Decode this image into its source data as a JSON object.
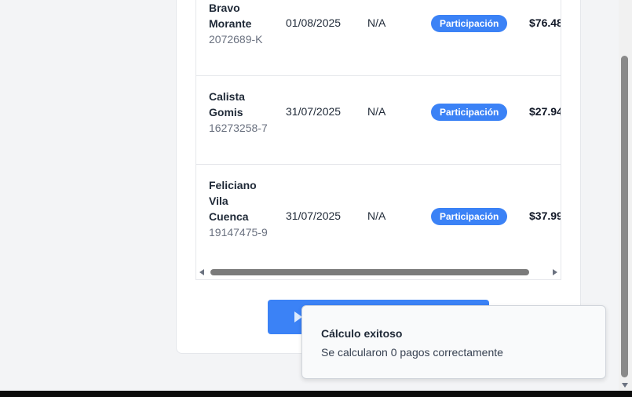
{
  "table": {
    "rows": [
      {
        "name": "Bravo Morante",
        "rut": "2072689-K",
        "date": "01/08/2025",
        "na": "N/A",
        "badge": "Participación",
        "amount": "$76.48"
      },
      {
        "name": "Calista Gomis",
        "rut": "16273258-7",
        "date": "31/07/2025",
        "na": "N/A",
        "badge": "Participación",
        "amount": "$27.94"
      },
      {
        "name": "Feliciano Vila Cuenca",
        "rut": "19147475-9",
        "date": "31/07/2025",
        "na": "N/A",
        "badge": "Participación",
        "amount": "$37.99"
      }
    ]
  },
  "toast": {
    "title": "Cálculo exitoso",
    "message": "Se calcularon 0 pagos correctamente"
  },
  "colors": {
    "accent": "#3b82f6",
    "background": "#f3f4f6"
  },
  "icons": {
    "calc_button": "play-icon"
  }
}
